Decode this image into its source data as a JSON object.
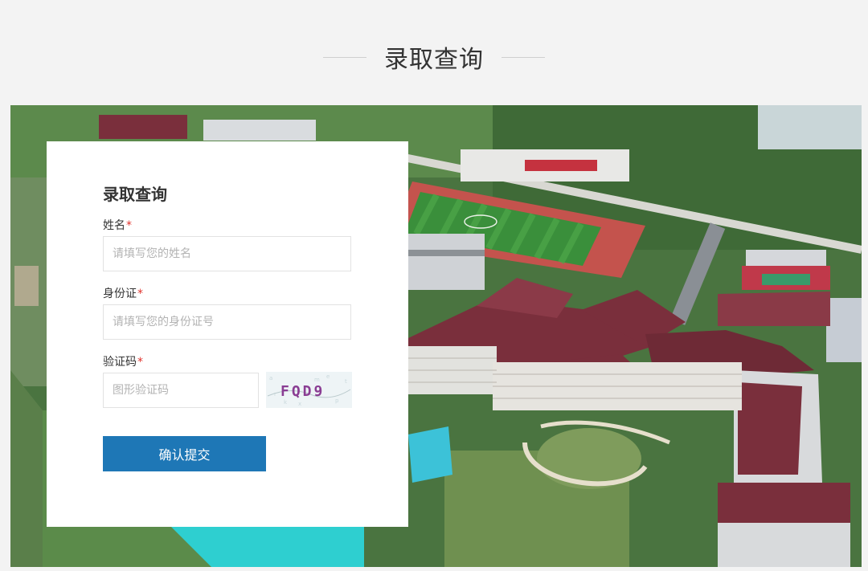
{
  "section": {
    "title": "录取查询"
  },
  "form": {
    "title": "录取查询",
    "required_mark": "*",
    "name": {
      "label": "姓名",
      "placeholder": "请填写您的姓名",
      "value": ""
    },
    "id_card": {
      "label": "身份证",
      "placeholder": "请填写您的身份证号",
      "value": ""
    },
    "captcha": {
      "label": "验证码",
      "placeholder": "图形验证码",
      "value": "",
      "image_text": "FQD9"
    },
    "submit_label": "确认提交"
  },
  "colors": {
    "page_bg": "#f3f3f3",
    "accent": "#1e77b6",
    "required": "#e0322c",
    "roof": "#7a2f3c"
  },
  "icons": []
}
